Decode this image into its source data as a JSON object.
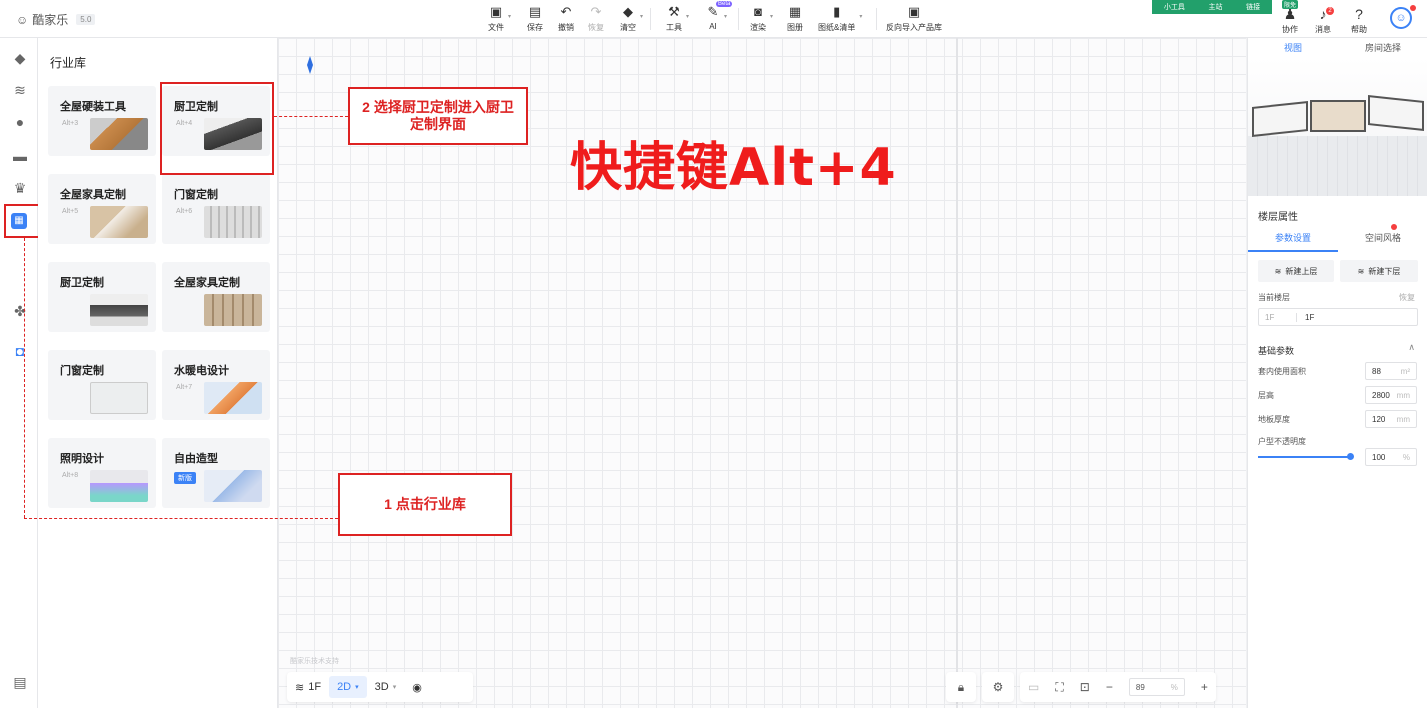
{
  "app": {
    "name": "酷家乐",
    "version": "5.0"
  },
  "toolbar": {
    "items": [
      {
        "label": "文件",
        "icon": "file-icon"
      },
      {
        "label": "保存",
        "icon": "save-icon"
      },
      {
        "label": "撤销",
        "icon": "undo-icon"
      },
      {
        "label": "恢复",
        "icon": "redo-icon"
      },
      {
        "label": "清空",
        "icon": "eraser-icon"
      },
      {
        "label": "工具",
        "icon": "wrench-icon"
      },
      {
        "label": "AI",
        "icon": "ai-icon",
        "badge": "Beta"
      },
      {
        "label": "渲染",
        "icon": "camera-icon"
      },
      {
        "label": "图册",
        "icon": "album-icon"
      },
      {
        "label": "图纸&清单",
        "icon": "drawing-list-icon"
      },
      {
        "label": "反向导入产品库",
        "icon": "import-icon"
      }
    ]
  },
  "topright": {
    "links": [
      "小工具",
      "主站",
      "链接"
    ],
    "collab_label": "协作",
    "collab_badge": "限免",
    "message_label": "消息",
    "message_count": "2",
    "help_label": "帮助"
  },
  "rail": {
    "icons": [
      "home-icon",
      "layers-icon",
      "bulb-icon",
      "sofa-icon",
      "crown-icon",
      "user-icon",
      "industry-library-icon",
      "puzzle-icon",
      "tag-icon",
      "settings-panel-icon"
    ]
  },
  "library": {
    "title": "行业库",
    "cards": [
      {
        "name": "全屋硬装工具",
        "key": "Alt+3"
      },
      {
        "name": "厨卫定制",
        "key": "Alt+4"
      },
      {
        "name": "全屋家具定制",
        "key": "Alt+5"
      },
      {
        "name": "门窗定制",
        "key": "Alt+6"
      },
      {
        "name": "厨卫定制",
        "key": ""
      },
      {
        "name": "全屋家具定制",
        "key": ""
      },
      {
        "name": "门窗定制",
        "key": ""
      },
      {
        "name": "水暖电设计",
        "key": "Alt+7"
      },
      {
        "name": "照明设计",
        "key": "Alt+8"
      },
      {
        "name": "自由造型",
        "key": "",
        "badge": "新版"
      }
    ]
  },
  "annotations": {
    "step2": "2 选择厨卫定制进入厨卫定制界面",
    "step1": "1 点击行业库",
    "shortcut": "快捷键Alt+4"
  },
  "canvas": {
    "watermark": "酷家乐技术支持"
  },
  "bottombar": {
    "floor": "1F",
    "mode_2d": "2D",
    "mode_3d": "3D",
    "zoom": "89",
    "zoom_unit": "%"
  },
  "rightpanel": {
    "tabs": [
      "视图",
      "房间选择"
    ],
    "floor_section": "楼层属性",
    "subtabs": [
      "参数设置",
      "空间风格"
    ],
    "new_upper": "新建上层",
    "new_lower": "新建下层",
    "current_floor_label": "当前楼层",
    "restore": "恢复",
    "floor_select": "1F",
    "floor_name": "1F",
    "basic_params": "基础参数",
    "fields": [
      {
        "label": "套内使用面积",
        "value": "88",
        "unit": "m²"
      },
      {
        "label": "层高",
        "value": "2800",
        "unit": "mm"
      },
      {
        "label": "地板厚度",
        "value": "120",
        "unit": "mm"
      }
    ],
    "opacity_label": "户型不透明度",
    "opacity_value": "100",
    "opacity_unit": "%",
    "opacity_level": 1.0
  },
  "colors": {
    "accent": "#3b82f6",
    "annotation": "#dd2222",
    "green": "#22a06b"
  }
}
